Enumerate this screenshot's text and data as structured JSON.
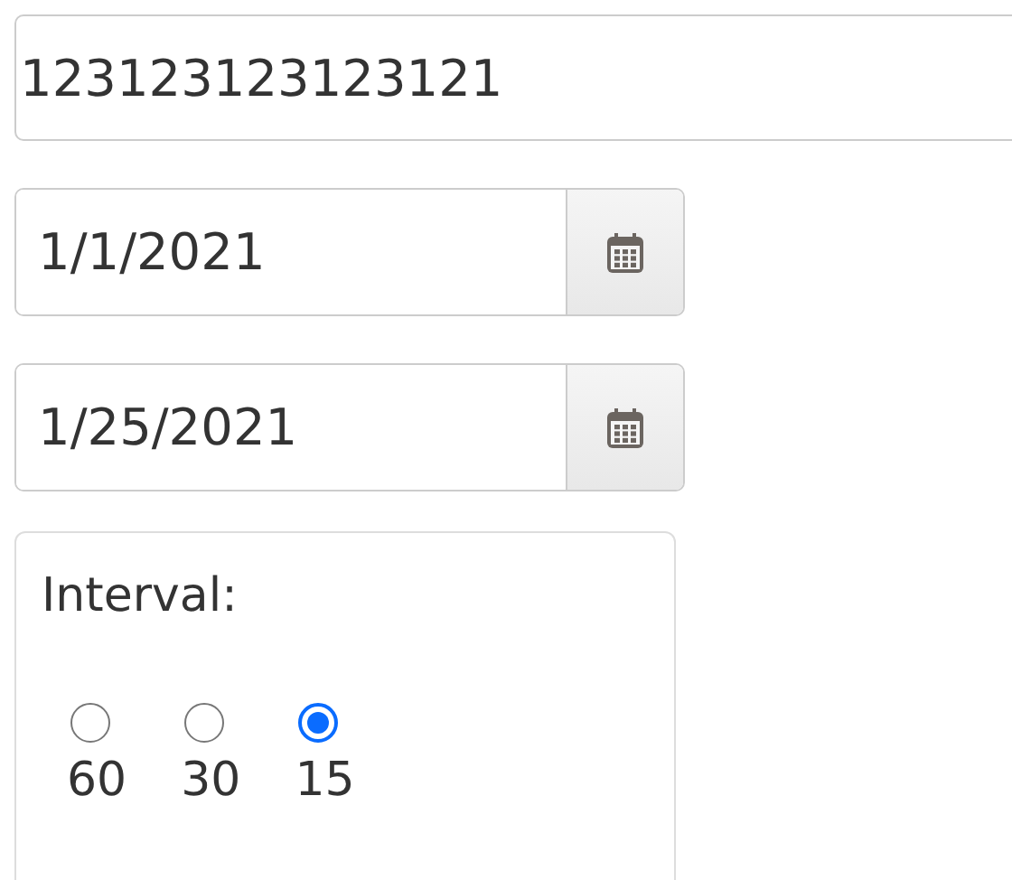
{
  "text_field": {
    "value": "123123123123121"
  },
  "date_fields": [
    {
      "value": "1/1/2021"
    },
    {
      "value": "1/25/2021"
    }
  ],
  "interval": {
    "label": "Interval:",
    "options": [
      {
        "label": "60",
        "selected": false
      },
      {
        "label": "30",
        "selected": false
      },
      {
        "label": "15",
        "selected": true
      }
    ]
  }
}
